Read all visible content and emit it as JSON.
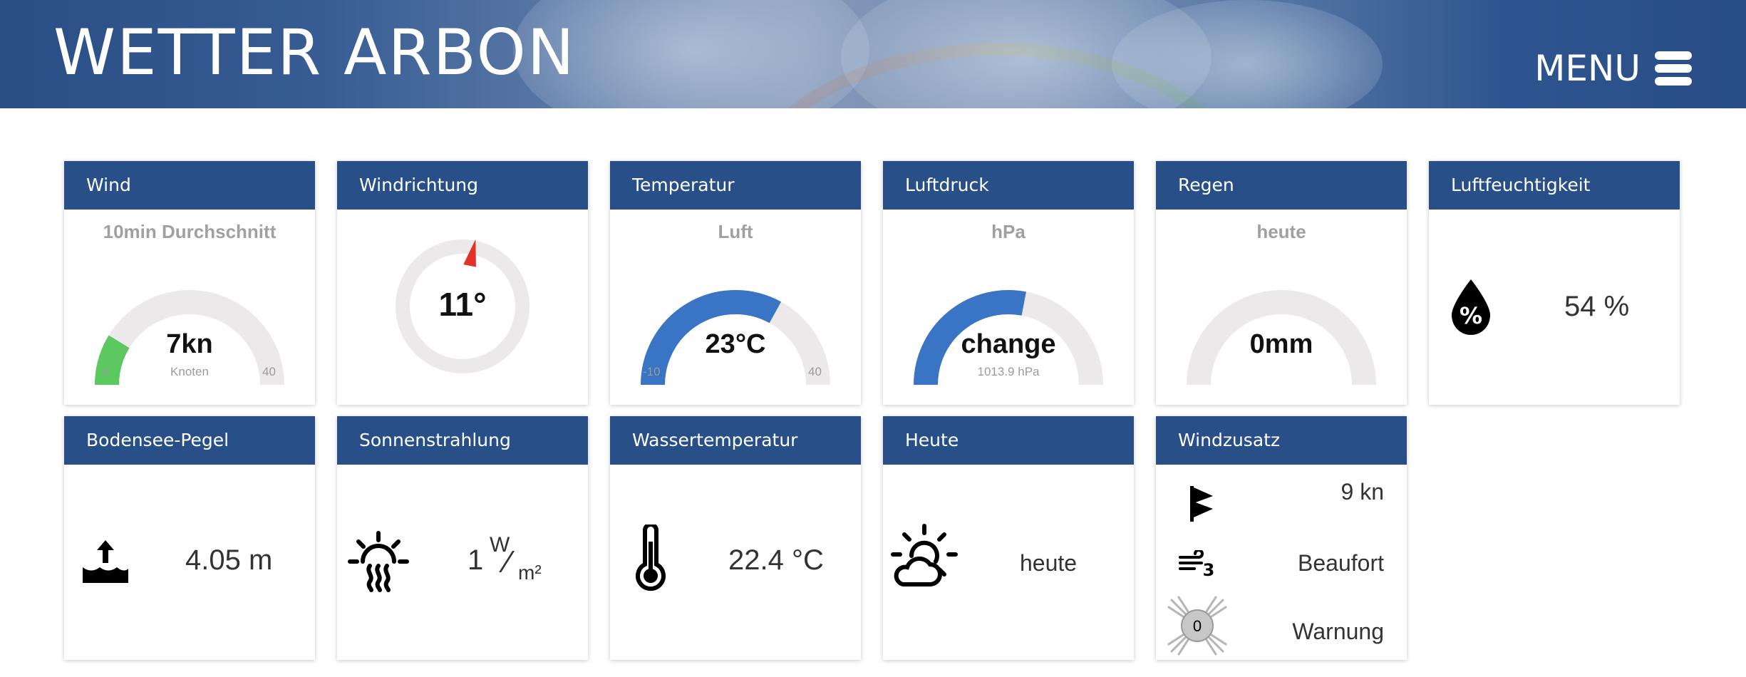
{
  "header": {
    "title": "WETTER ARBON",
    "menu_label": "MENU"
  },
  "cards": {
    "wind": {
      "title": "Wind",
      "subtitle": "10min Durchschnitt",
      "value": "7kn",
      "unit": "Knoten",
      "min": "0",
      "max": "40",
      "level": 0.175,
      "color": "#5cc860"
    },
    "windrichtung": {
      "title": "Windrichtung",
      "value": "11°",
      "direction_deg": 11,
      "color": "#e2322a"
    },
    "temperatur": {
      "title": "Temperatur",
      "subtitle": "Luft",
      "value": "23°C",
      "min": "-10",
      "max": "40",
      "level": 0.66,
      "color": "#3a74c4"
    },
    "luftdruck": {
      "title": "Luftdruck",
      "subtitle": "hPa",
      "value": "change",
      "note": "1013.9 hPa",
      "level": 0.56,
      "color": "#3a74c4"
    },
    "regen": {
      "title": "Regen",
      "subtitle": "heute",
      "value": "0mm",
      "level": 0
    },
    "luftfeuchtigkeit": {
      "title": "Luftfeuchtigkeit",
      "value": "54 %",
      "icon": "humidity-drop-icon"
    },
    "bodensee": {
      "title": "Bodensee-Pegel",
      "value": "4.05 m",
      "icon": "water-level-icon"
    },
    "sonnenstrahlung": {
      "title": "Sonnenstrahlung",
      "value": "1",
      "unit_num": "W",
      "unit_slash": "⁄",
      "unit_den": "m²",
      "icon": "sun-radiation-icon"
    },
    "wassertemperatur": {
      "title": "Wassertemperatur",
      "value": "22.4 °C",
      "icon": "thermometer-icon"
    },
    "heute": {
      "title": "Heute",
      "value": "heute",
      "icon": "partly-cloudy-icon"
    },
    "windzusatz": {
      "title": "Windzusatz",
      "gust_value": "9 kn",
      "beaufort_label": "Beaufort",
      "warning_label": "Warnung",
      "warning_level": "0",
      "icons": [
        "gust-flag-icon",
        "beaufort-wind-icon",
        "warning-light-icon"
      ]
    }
  }
}
